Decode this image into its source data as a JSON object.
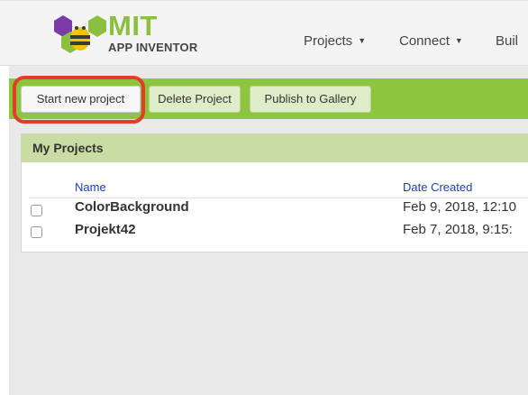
{
  "header": {
    "logo_title": "MIT",
    "logo_subtitle": "APP INVENTOR",
    "nav": [
      {
        "label": "Projects"
      },
      {
        "label": "Connect"
      },
      {
        "label": "Buil"
      }
    ]
  },
  "toolbar": {
    "start_label": "Start new project",
    "delete_label": "Delete Project",
    "publish_label": "Publish to Gallery"
  },
  "projects": {
    "title": "My Projects",
    "columns": {
      "name": "Name",
      "date": "Date Created"
    },
    "rows": [
      {
        "name": "ColorBackground",
        "date": "Feb 9, 2018, 12:10"
      },
      {
        "name": "Projekt42",
        "date": "Feb 7, 2018, 9:15:"
      }
    ]
  },
  "colors": {
    "toolbar_green": "#8cc63f",
    "panel_header": "#c9dca4",
    "highlight_red": "#e53b2a",
    "column_blue": "#1f3db8"
  }
}
